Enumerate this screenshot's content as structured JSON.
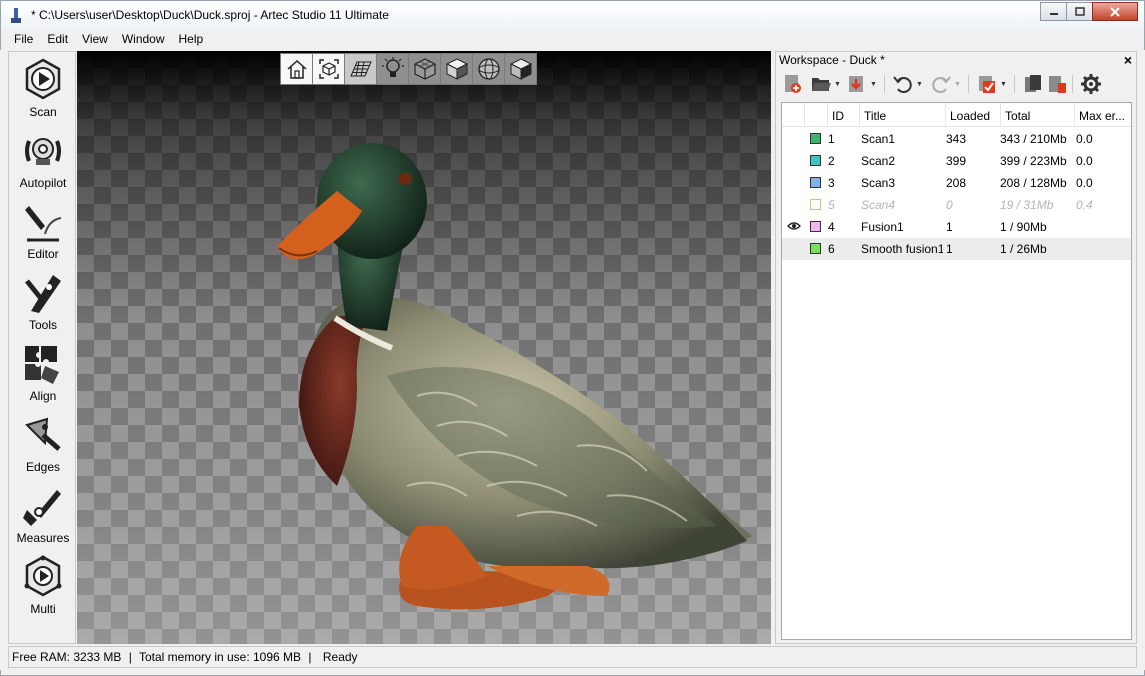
{
  "window": {
    "title": "* C:\\Users\\user\\Desktop\\Duck\\Duck.sproj - Artec Studio 11 Ultimate",
    "buttons": [
      "minimize-icon",
      "maximize-icon",
      "close-icon"
    ]
  },
  "menu": [
    "File",
    "Edit",
    "View",
    "Window",
    "Help"
  ],
  "sidebar": {
    "tools": [
      {
        "label": "Scan",
        "icon": "scan-icon"
      },
      {
        "label": "Autopilot",
        "icon": "autopilot-icon"
      },
      {
        "label": "Editor",
        "icon": "editor-icon"
      },
      {
        "label": "Tools",
        "icon": "tools-icon"
      },
      {
        "label": "Align",
        "icon": "align-icon"
      },
      {
        "label": "Edges",
        "icon": "edges-icon"
      },
      {
        "label": "Measures",
        "icon": "measures-icon"
      },
      {
        "label": "Multi",
        "icon": "multi-icon"
      }
    ]
  },
  "viewport": {
    "toolbar_icons": [
      "home-view-icon",
      "fit-view-icon",
      "grid-icon",
      "light-icon",
      "wireframe-cube-icon",
      "solid-cube-icon",
      "sphere-icon",
      "textured-cube-icon"
    ]
  },
  "workspace": {
    "title": "Workspace - Duck *",
    "columns": [
      "ID",
      "Title",
      "Loaded",
      "Total",
      "Max er..."
    ],
    "rows": [
      {
        "id": "1",
        "title": "Scan1",
        "loaded": "343",
        "total": "343 / 210Mb",
        "max_err": "0.0",
        "color": "#3cb371",
        "visible": false,
        "dim": false
      },
      {
        "id": "2",
        "title": "Scan2",
        "loaded": "399",
        "total": "399 / 223Mb",
        "max_err": "0.0",
        "color": "#40c4c4",
        "visible": false,
        "dim": false
      },
      {
        "id": "3",
        "title": "Scan3",
        "loaded": "208",
        "total": "208 / 128Mb",
        "max_err": "0.0",
        "color": "#7fb2e8",
        "visible": false,
        "dim": false
      },
      {
        "id": "5",
        "title": "Scan4",
        "loaded": "0",
        "total": "19 / 31Mb",
        "max_err": "0.4",
        "color": "#ffffff",
        "visible": false,
        "dim": true
      },
      {
        "id": "4",
        "title": "Fusion1",
        "loaded": "1",
        "total": "1 / 90Mb",
        "max_err": "",
        "color": "#f0b4f0",
        "visible": true,
        "dim": false
      },
      {
        "id": "6",
        "title": "Smooth fusion1",
        "loaded": "1",
        "total": "1 / 26Mb",
        "max_err": "",
        "color": "#78e05a",
        "visible": false,
        "dim": false
      }
    ]
  },
  "status": {
    "free_ram": "Free RAM: 3233 MB",
    "total_memory": "Total memory in use: 1096 MB",
    "state": "Ready",
    "separator": "|"
  }
}
